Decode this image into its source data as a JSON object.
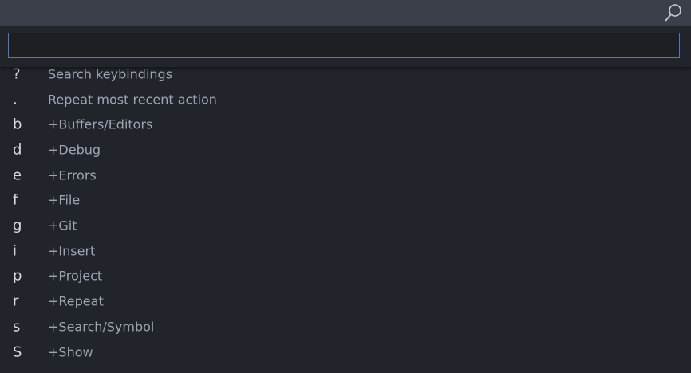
{
  "header": {
    "search_icon": "search-icon"
  },
  "quick_input": {
    "value": "",
    "placeholder": ""
  },
  "colors": {
    "background": "#21252b",
    "topbar": "#3b3f4a",
    "input_border": "#4d78cc",
    "key_text": "#d7dae0",
    "label_text": "#9da5b4"
  },
  "items": [
    {
      "key": "?",
      "label": "Search keybindings"
    },
    {
      "key": ".",
      "label": "Repeat most recent action"
    },
    {
      "key": "b",
      "label": "+Buffers/Editors"
    },
    {
      "key": "d",
      "label": "+Debug"
    },
    {
      "key": "e",
      "label": "+Errors"
    },
    {
      "key": "f",
      "label": "+File"
    },
    {
      "key": "g",
      "label": "+Git"
    },
    {
      "key": "i",
      "label": "+Insert"
    },
    {
      "key": "p",
      "label": "+Project"
    },
    {
      "key": "r",
      "label": "+Repeat"
    },
    {
      "key": "s",
      "label": "+Search/Symbol"
    },
    {
      "key": "S",
      "label": "+Show"
    }
  ]
}
